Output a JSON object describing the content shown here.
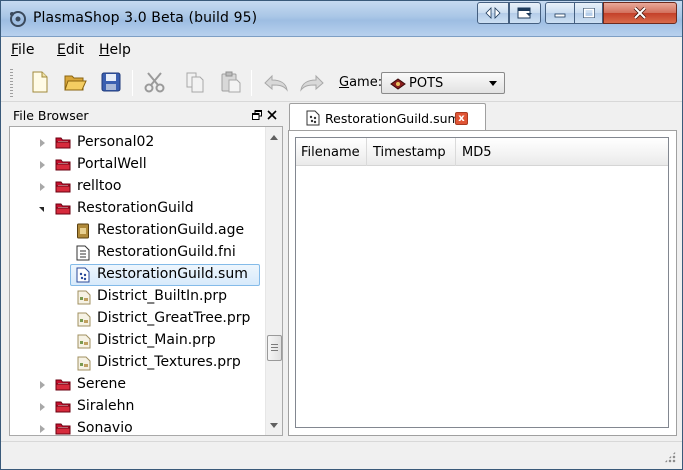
{
  "window": {
    "title": "PlasmaShop 3.0 Beta (build 95)"
  },
  "menu": {
    "items": [
      {
        "label": "File",
        "mnemonic": "F",
        "rest": "ile"
      },
      {
        "label": "Edit",
        "mnemonic": "E",
        "rest": "dit"
      },
      {
        "label": "Help",
        "mnemonic": "H",
        "rest": "elp"
      }
    ]
  },
  "toolbar": {
    "buttons": [
      "new-file-icon",
      "open-folder-icon",
      "save-icon",
      "cut-icon",
      "copy-icon",
      "paste-icon",
      "undo-icon",
      "redo-icon"
    ],
    "game_label": "Game:",
    "game_mnemonic": "G",
    "game_rest": "ame:",
    "game_value": "POTS"
  },
  "file_browser": {
    "title": "File Browser",
    "items": [
      {
        "label": "Personal02",
        "type": "folder",
        "expanded": false,
        "depth": 0
      },
      {
        "label": "PortalWell",
        "type": "folder",
        "expanded": false,
        "depth": 0
      },
      {
        "label": "relltoo",
        "type": "folder",
        "expanded": false,
        "depth": 0
      },
      {
        "label": "RestorationGuild",
        "type": "folder",
        "expanded": true,
        "depth": 0
      },
      {
        "label": "RestorationGuild.age",
        "type": "age",
        "depth": 1
      },
      {
        "label": "RestorationGuild.fni",
        "type": "fni",
        "depth": 1
      },
      {
        "label": "RestorationGuild.sum",
        "type": "sum",
        "depth": 1,
        "selected": true
      },
      {
        "label": "District_BuiltIn.prp",
        "type": "prp",
        "depth": 1
      },
      {
        "label": "District_GreatTree.prp",
        "type": "prp",
        "depth": 1
      },
      {
        "label": "District_Main.prp",
        "type": "prp",
        "depth": 1
      },
      {
        "label": "District_Textures.prp",
        "type": "prp",
        "depth": 1
      },
      {
        "label": "Serene",
        "type": "folder",
        "expanded": false,
        "depth": 0
      },
      {
        "label": "Siralehn",
        "type": "folder",
        "expanded": false,
        "depth": 0
      },
      {
        "label": "Sonavio",
        "type": "folder",
        "expanded": false,
        "depth": 0
      }
    ]
  },
  "document": {
    "tab_label": "RestorationGuild.sum",
    "close_label": "x",
    "columns": [
      "Filename",
      "Timestamp",
      "MD5"
    ]
  },
  "colors": {
    "folder": "#c8102e",
    "selection_border": "#84bbe9",
    "close_red": "#e05535"
  }
}
